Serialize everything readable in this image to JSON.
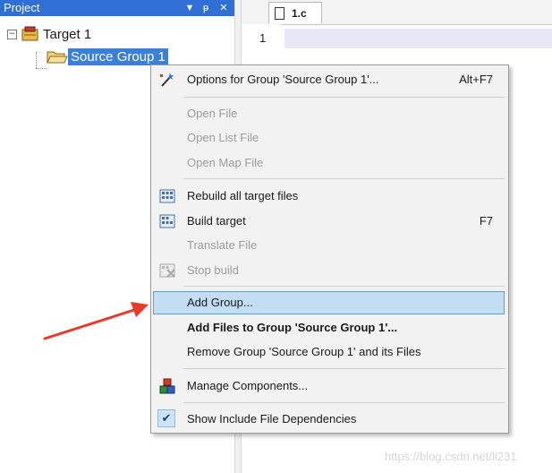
{
  "project_pane": {
    "title": "Project",
    "buttons": {
      "dropdown": "▼",
      "pin": "ᵽ",
      "close": "✕"
    },
    "tree": {
      "target": {
        "label": "Target 1",
        "expander": "−"
      },
      "group": {
        "label": "Source Group 1"
      }
    }
  },
  "editor": {
    "tab": {
      "label": "1.c"
    },
    "line_number": "1"
  },
  "context_menu": {
    "items": [
      {
        "label": "Options for Group 'Source Group 1'...",
        "shortcut": "Alt+F7"
      },
      {
        "label": "Open File"
      },
      {
        "label": "Open List File"
      },
      {
        "label": "Open Map File"
      },
      {
        "label": "Rebuild all target files"
      },
      {
        "label": "Build target",
        "shortcut": "F7"
      },
      {
        "label": "Translate File"
      },
      {
        "label": "Stop build"
      },
      {
        "label": "Add Group..."
      },
      {
        "label": "Add Files to Group 'Source Group 1'..."
      },
      {
        "label": "Remove Group 'Source Group 1' and its Files"
      },
      {
        "label": "Manage Components..."
      },
      {
        "label": "Show Include File Dependencies",
        "checked": true
      }
    ]
  },
  "annotation": {
    "arrow_color": "#e8392b"
  },
  "watermark": "https://blog.csdn.net/li231"
}
